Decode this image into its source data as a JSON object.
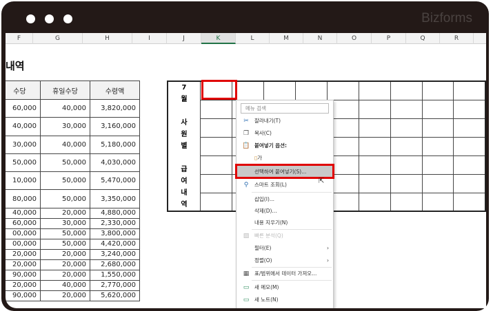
{
  "window": {
    "brand": "Bizforms"
  },
  "columns": [
    "F",
    "G",
    "H",
    "I",
    "J",
    "K",
    "L",
    "M",
    "N",
    "O",
    "P",
    "Q",
    "R"
  ],
  "selected_column": "K",
  "sheet_title": "내역",
  "left_table": {
    "headers": [
      "수당",
      "휴일수당",
      "수령액"
    ],
    "rows": [
      [
        "60,000",
        "40,000",
        "3,820,000"
      ],
      [
        "40,000",
        "30,000",
        "3,160,000"
      ],
      [
        "30,000",
        "40,000",
        "5,180,000"
      ],
      [
        "50,000",
        "50,000",
        "4,030,000"
      ],
      [
        "10,000",
        "50,000",
        "5,470,000"
      ],
      [
        "80,000",
        "50,000",
        "3,350,000"
      ],
      [
        "40,000",
        "20,000",
        "4,880,000"
      ],
      [
        "60,000",
        "30,000",
        "2,330,000"
      ],
      [
        "00,000",
        "50,000",
        "3,800,000"
      ],
      [
        "00,000",
        "50,000",
        "4,420,000"
      ],
      [
        "20,000",
        "20,000",
        "3,240,000"
      ],
      [
        "20,000",
        "20,000",
        "2,680,000"
      ],
      [
        "90,000",
        "20,000",
        "1,550,000"
      ],
      [
        "20,000",
        "40,000",
        "2,770,000"
      ],
      [
        "90,000",
        "20,000",
        "5,620,000"
      ]
    ]
  },
  "right_table": {
    "label": "7\n월\n\n사\n원\n별\n\n급\n여\n내\n역"
  },
  "context_menu": {
    "search_placeholder": "메뉴 검색",
    "cut": "잘라내기(T)",
    "copy": "복사(C)",
    "paste_options": "붙여넣기 옵션:",
    "paste_icon_label": "가",
    "paste_special": "선택하여 붙여넣기(S)...",
    "smart_lookup": "스마트 조회(L)",
    "insert": "삽입(I)...",
    "delete": "삭제(D)...",
    "clear": "내용 지우기(N)",
    "quick_analysis": "빠른 분석(Q)",
    "filter": "필터(E)",
    "sort": "정렬(O)",
    "get_data": "표/범위에서 데이터 가져오...",
    "new_comment": "새 메모(M)",
    "new_note": "새 노트(N)"
  }
}
